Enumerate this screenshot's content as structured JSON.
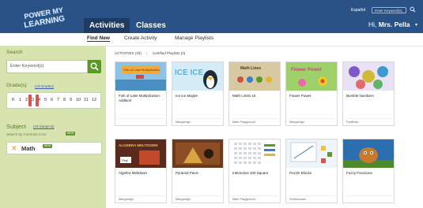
{
  "header": {
    "logo_line1": "POWER MY",
    "logo_line2": "LEARNING",
    "tabs": [
      {
        "label": "Activities",
        "active": true
      },
      {
        "label": "Classes",
        "active": false
      }
    ],
    "language": "Español",
    "search_placeholder": "Enter Keyword(s)",
    "greeting_prefix": "Hi,",
    "user_name": "Mrs. Pella"
  },
  "subnav": {
    "items": [
      {
        "label": "Find New",
        "active": true
      },
      {
        "label": "Create Activity",
        "active": false
      },
      {
        "label": "Manage Playlists",
        "active": false
      }
    ]
  },
  "sidebar": {
    "search_label": "Search",
    "search_placeholder": "Enter Keyword(s)",
    "grades_label": "Grade(s)",
    "grades_link": "(All Grades)",
    "grades": [
      "K",
      "1",
      "2",
      "3",
      "4",
      "5",
      "6",
      "7",
      "8",
      "9",
      "10",
      "11",
      "12"
    ],
    "selected_grades": [
      "3",
      "4"
    ],
    "subject_label": "Subject",
    "subject_link": "(All Subjects)",
    "common_core_label": "Search by Common Core",
    "common_core_badge": "NEW",
    "subject_item": "Math",
    "subject_item_badge": "NEW"
  },
  "filters": {
    "activities": "ACTIVITIES (33)",
    "separator": "|",
    "certified": "Certified Playlists (0)"
  },
  "cards": [
    {
      "title": "Fish of Lake Multiplication: Addition",
      "publisher": ""
    },
    {
      "title": "Ice Ice Maybe",
      "publisher": "Mangahigh"
    },
    {
      "title": "Math Limits 10",
      "publisher": "Math Playground"
    },
    {
      "title": "Flower Power",
      "publisher": "Mangahigh"
    },
    {
      "title": "Bumble Numbers",
      "publisher": "FunBrain"
    },
    {
      "title": "Algebra Meltdown",
      "publisher": "Mangahigh"
    },
    {
      "title": "Pyramid Panic",
      "publisher": "Mangahigh"
    },
    {
      "title": "Interactive 100 Square",
      "publisher": "Math Playground"
    },
    {
      "title": "Puzzle Blocks",
      "publisher": "Smithsonian"
    },
    {
      "title": "Fuzzy Functions",
      "publisher": ""
    }
  ],
  "thumb_texts": {
    "fish": "Fish of Lake Multiplication",
    "ice": "ICE ICE",
    "math": "Math Lines",
    "flower": "Flower Power",
    "algebra": "ALGEBRA MELTDOWN",
    "play": "Play"
  },
  "colors": {
    "header_bg": "#2b5286",
    "sidebar_bg": "#d8e4b0",
    "accent_green": "#5c9a28",
    "grade_selected": "#d9534f"
  }
}
